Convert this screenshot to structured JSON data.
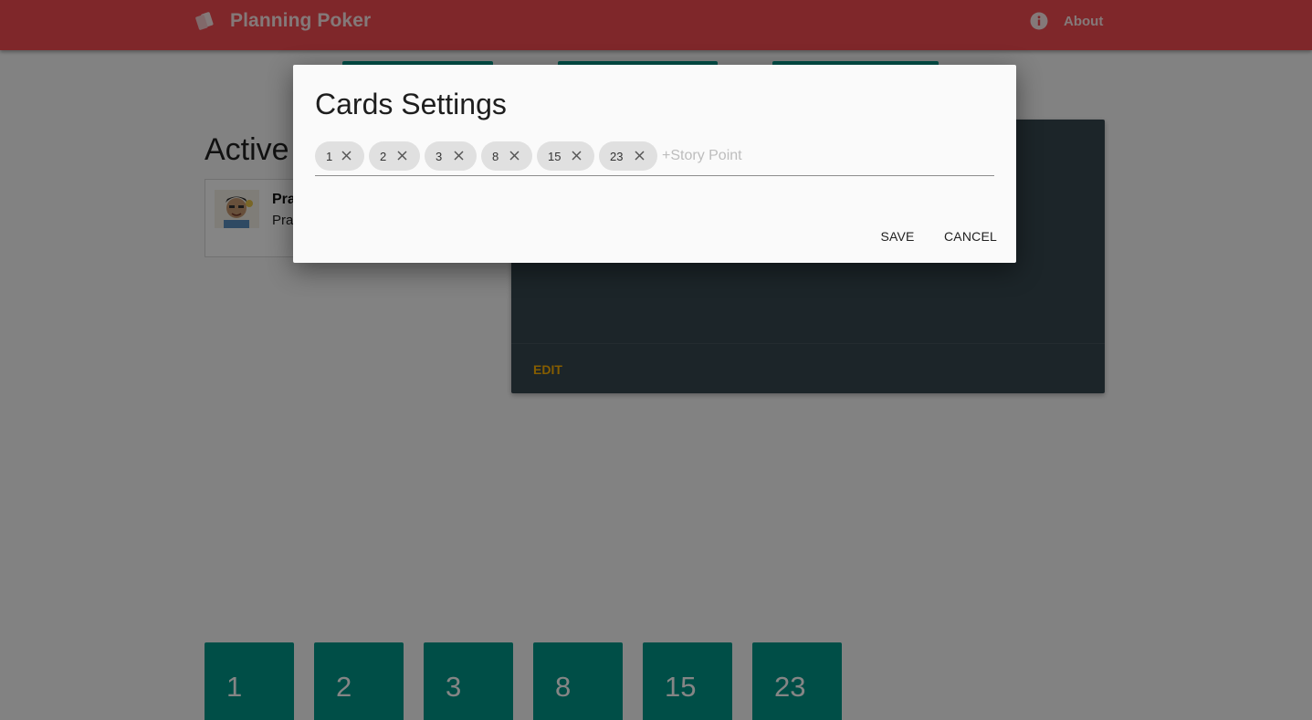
{
  "header": {
    "brand": "Planning Poker",
    "about": "About",
    "bg_color": "#f44b52"
  },
  "page": {
    "active_title": "Active",
    "user": {
      "name": "Pra",
      "subtitle": "Pra"
    },
    "story_panel": {
      "edit_label": "EDIT"
    },
    "vote_cards": [
      "1",
      "2",
      "3",
      "8",
      "15",
      "23"
    ]
  },
  "dialog": {
    "title": "Cards Settings",
    "chips": [
      "1",
      "2",
      "3",
      "8",
      "15",
      "23"
    ],
    "input_placeholder": "+Story Point",
    "save_label": "SAVE",
    "cancel_label": "CANCEL"
  },
  "colors": {
    "accent": "#009688",
    "panel": "#37474f",
    "edit": "#ffb300"
  },
  "icons": {
    "brand": "cards-icon",
    "about": "info-icon",
    "chip_remove": "close-icon"
  }
}
